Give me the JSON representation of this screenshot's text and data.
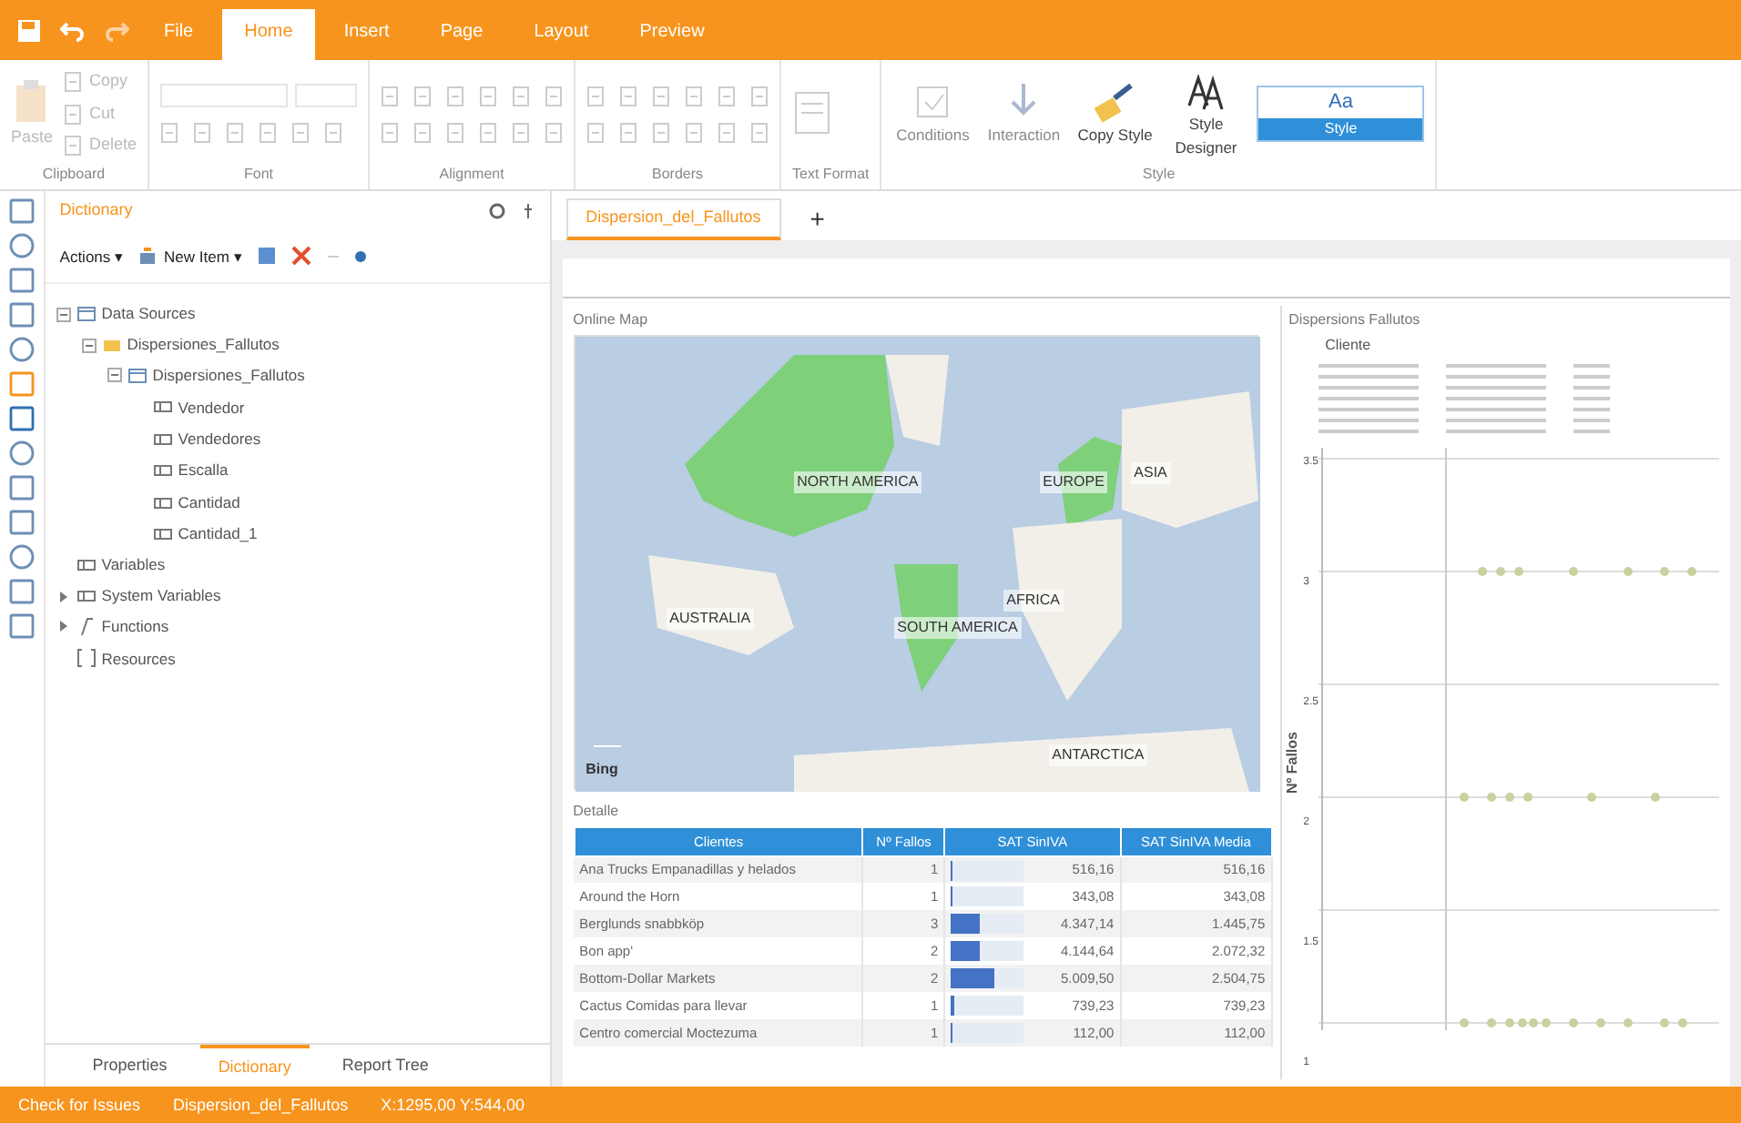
{
  "ribbon_tabs": [
    {
      "label": "File",
      "selected": false
    },
    {
      "label": "Home",
      "selected": true
    },
    {
      "label": "Insert",
      "selected": false
    },
    {
      "label": "Page",
      "selected": false
    },
    {
      "label": "Layout",
      "selected": false
    },
    {
      "label": "Preview",
      "selected": false
    }
  ],
  "ribbon_groups": [
    {
      "title": "Clipboard",
      "kind": "clipboard",
      "big": "Paste",
      "small": [
        "Copy",
        "Cut",
        "Delete"
      ]
    },
    {
      "title": "Font",
      "kind": "font"
    },
    {
      "title": "Alignment",
      "kind": "align"
    },
    {
      "title": "Borders",
      "kind": "borders"
    },
    {
      "title": "Text Format",
      "kind": "textformat"
    },
    {
      "title": "Style",
      "kind": "style",
      "buttons": [
        {
          "label": "Conditions",
          "disabled": true
        },
        {
          "label": "Interaction",
          "disabled": true
        },
        {
          "label": "Copy Style",
          "disabled": false
        },
        {
          "label": "Style Designer",
          "disabled": false
        }
      ],
      "gallery": {
        "sample": "Aa",
        "name": "Style"
      }
    }
  ],
  "dictionary": {
    "title": "Dictionary",
    "actions": "Actions ▾",
    "new_item": "New Item ▾",
    "tree": [
      {
        "label": "Data Sources",
        "kind": "source",
        "expanded": true,
        "children": [
          {
            "label": "Dispersiones_Fallutos",
            "kind": "connection",
            "expanded": true,
            "children": [
              {
                "label": "Dispersiones_Fallutos",
                "kind": "source",
                "expanded": true,
                "children": [
                  {
                    "label": "Vendedor",
                    "kind": "column"
                  },
                  {
                    "label": "Vendedores",
                    "kind": "column"
                  },
                  {
                    "label": "Escalla",
                    "kind": "column"
                  },
                  {
                    "label": "Cantidad",
                    "kind": "column"
                  },
                  {
                    "label": "Cantidad_1",
                    "kind": "column"
                  }
                ]
              }
            ]
          }
        ]
      },
      {
        "label": "Variables",
        "kind": "column"
      },
      {
        "label": "System Variables",
        "kind": "column",
        "expanded": false
      },
      {
        "label": "Functions",
        "kind": "function",
        "expanded": false
      },
      {
        "label": "Resources",
        "kind": "resource"
      }
    ]
  },
  "panel_tabs": [
    {
      "label": "Properties",
      "selected": false
    },
    {
      "label": "Dictionary",
      "selected": true
    },
    {
      "label": "Report Tree",
      "selected": false
    }
  ],
  "report_tab": {
    "label": "Dispersion_del_Fallutos",
    "add": "+"
  },
  "map": {
    "title": "Online Map",
    "attribution": "Bing",
    "continents": [
      {
        "label": "NORTH AMERICA",
        "highlighted": true
      },
      {
        "label": "EUROPE",
        "highlighted": true
      },
      {
        "label": "ASIA",
        "highlighted": false
      },
      {
        "label": "AFRICA",
        "highlighted": false
      },
      {
        "label": "SOUTH AMERICA",
        "highlighted": true
      },
      {
        "label": "AUSTRALIA",
        "highlighted": false
      },
      {
        "label": "ANTARCTICA",
        "highlighted": false
      }
    ]
  },
  "table": {
    "title": "Detalle",
    "columns": [
      "Clientes",
      "Nº Fallos",
      "SAT SinIVA",
      "SAT SinIVA Media"
    ],
    "rows": [
      {
        "name": "Ana Trucks Empanadillas y helados",
        "count": "1",
        "level": 0.03,
        "total": "516,16",
        "mean": "516,16"
      },
      {
        "name": "Around the Horn",
        "count": "1",
        "level": 0.03,
        "total": "343,08",
        "mean": "343,08"
      },
      {
        "name": "Berglunds snabbköp",
        "count": "3",
        "level": 0.4,
        "total": "4.347,14",
        "mean": "1.445,75"
      },
      {
        "name": "Bon app'",
        "count": "2",
        "level": 0.4,
        "total": "4.144,64",
        "mean": "2.072,32"
      },
      {
        "name": "Bottom-Dollar Markets",
        "count": "2",
        "level": 0.6,
        "total": "5.009,50",
        "mean": "2.504,75"
      },
      {
        "name": "Cactus Comidas para llevar",
        "count": "1",
        "level": 0.05,
        "total": "739,23",
        "mean": "739,23"
      },
      {
        "name": "Centro comercial Moctezuma",
        "count": "1",
        "level": 0.01,
        "total": "112,00",
        "mean": "112,00"
      }
    ]
  },
  "scatter": {
    "title": "Dispersions Fallutos",
    "legend_title": "Cliente",
    "ylabel": "Nº Fallos",
    "yticks": [
      "3.5",
      "3",
      "2.5",
      "2",
      "1.5",
      "1"
    ]
  },
  "status_bar": {
    "issues": "Check for Issues",
    "page": "Dispersion_del_Fallutos",
    "coords": "X:1295,00 Y:544,00"
  }
}
